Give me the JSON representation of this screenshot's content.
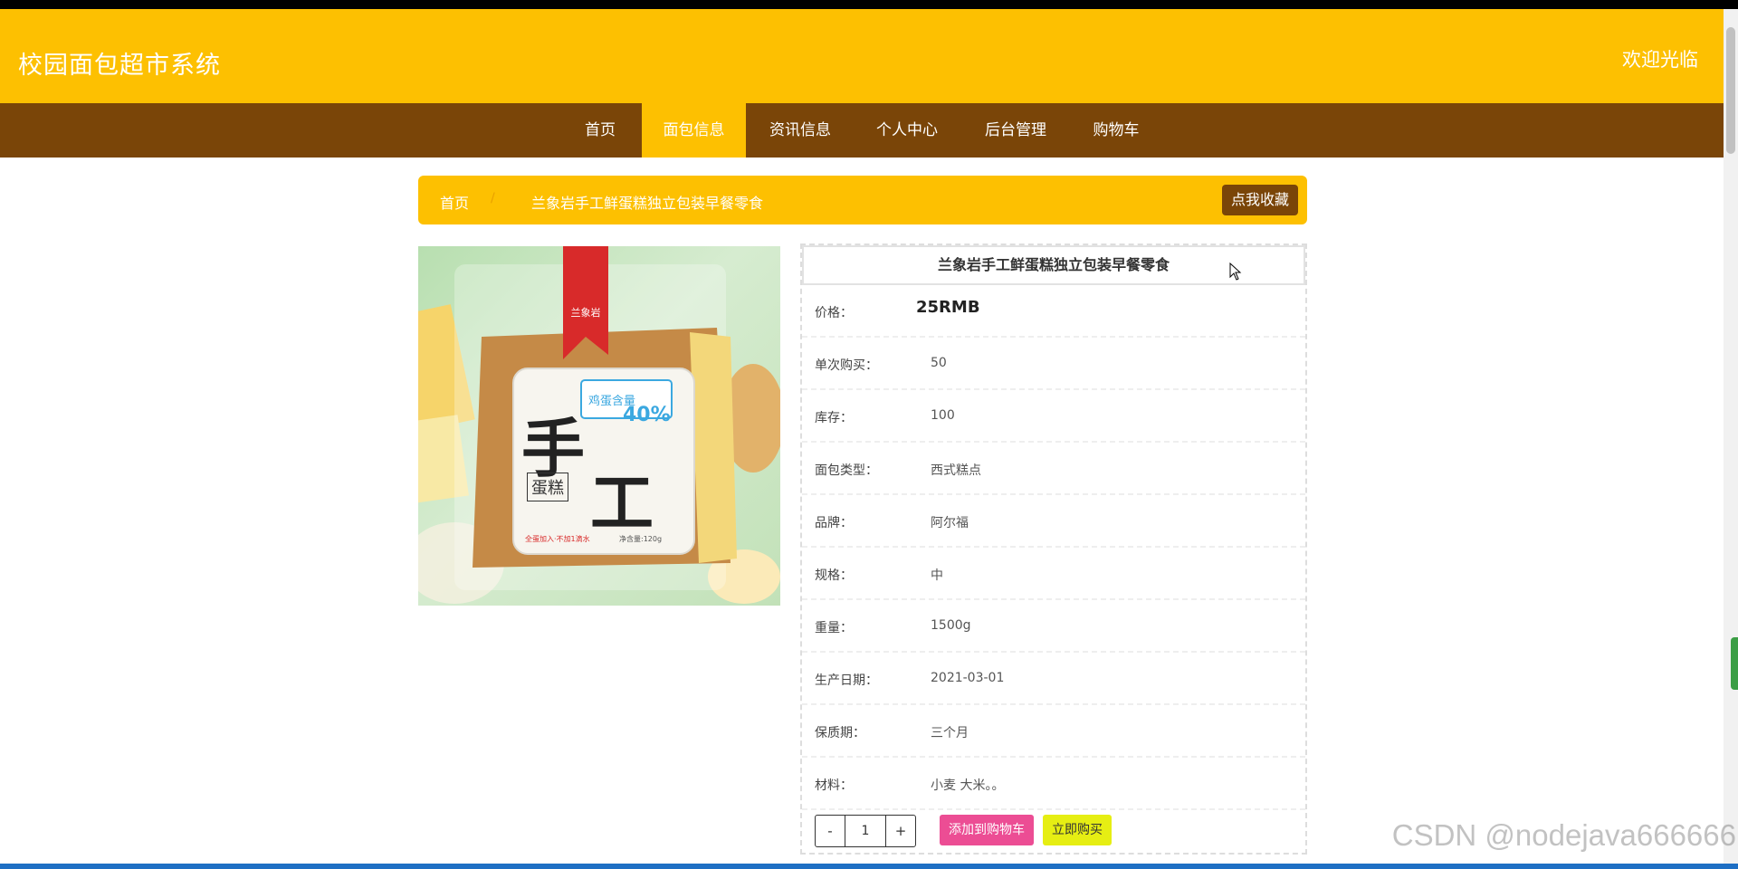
{
  "header": {
    "site_title": "校园面包超市系统",
    "welcome": "欢迎光临"
  },
  "nav": {
    "items": [
      {
        "label": "首页"
      },
      {
        "label": "面包信息"
      },
      {
        "label": "资讯信息"
      },
      {
        "label": "个人中心"
      },
      {
        "label": "后台管理"
      },
      {
        "label": "购物车"
      }
    ],
    "active": "面包信息"
  },
  "breadcrumb": {
    "home": "首页",
    "separator": "/",
    "current": "兰象岩手工鲜蛋糕独立包装早餐零食",
    "favorite_button": "点我收藏"
  },
  "product_image": {
    "ribbon_text": "兰象岩",
    "badge_text": "鸡蛋含量",
    "badge_value": "40%",
    "big_char_1": "手",
    "big_char_2": "工",
    "small_label": "蛋糕",
    "footer_text": "全蛋加入·不加1滴水",
    "net_weight": "净含量:120g"
  },
  "product": {
    "title": "兰象岩手工鲜蛋糕独立包装早餐零食",
    "fields": [
      {
        "label": "价格：",
        "value": "25RMB"
      },
      {
        "label": "单次购买：",
        "value": "50"
      },
      {
        "label": "库存：",
        "value": "100"
      },
      {
        "label": "面包类型：",
        "value": "西式糕点"
      },
      {
        "label": "品牌：",
        "value": "阿尔福"
      },
      {
        "label": "规格：",
        "value": "中"
      },
      {
        "label": "重量：",
        "value": "1500g"
      },
      {
        "label": "生产日期：",
        "value": "2021-03-01"
      },
      {
        "label": "保质期：",
        "value": "三个月"
      },
      {
        "label": "材料：",
        "value": "小麦 大米。。"
      }
    ]
  },
  "purchase": {
    "minus": "-",
    "quantity": "1",
    "plus": "+",
    "add_to_cart": "添加到购物车",
    "buy_now": "立即购买"
  },
  "watermark": "CSDN @nodejava666666",
  "colors": {
    "header_yellow": "#fdc001",
    "nav_brown": "#7a4508",
    "cart_pink": "#ec4d94",
    "buy_yellow": "#e6ee13"
  }
}
